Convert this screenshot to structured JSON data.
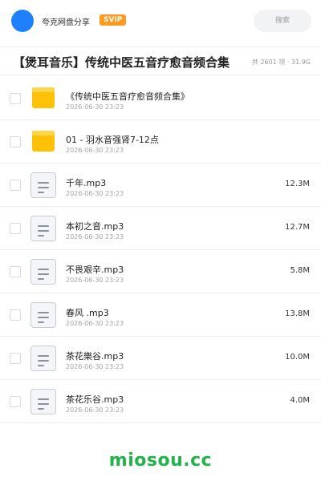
{
  "header": {
    "site_name": "夸克网盘分享",
    "badge": "SVIP",
    "search_label": "搜索"
  },
  "share": {
    "title": "【煲耳音乐】传统中医五音疗愈音频合集",
    "meta": "共 2601 项 · 31.9G"
  },
  "files": [
    {
      "type": "folder",
      "name": "《传统中医五音疗愈音频合集》",
      "date": "2026-06-30 23:23",
      "size": ""
    },
    {
      "type": "folder",
      "name": "01 - 羽水音强肾7-12点",
      "date": "2026-06-30 23:23",
      "size": ""
    },
    {
      "type": "file",
      "name": "千年.mp3",
      "date": "2026-06-30 23:23",
      "size": "12.3M"
    },
    {
      "type": "file",
      "name": "本初之音.mp3",
      "date": "2026-06-30 23:23",
      "size": "12.7M"
    },
    {
      "type": "file",
      "name": "不畏艰辛.mp3",
      "date": "2026-06-30 23:23",
      "size": "5.8M"
    },
    {
      "type": "file",
      "name": "春风 .mp3",
      "date": "2026-06-30 23:23",
      "size": "13.8M"
    },
    {
      "type": "file",
      "name": "茶花樂谷.mp3",
      "date": "2026-06-30 23:23",
      "size": "10.0M"
    },
    {
      "type": "file",
      "name": "茶花乐谷.mp3",
      "date": "2026-06-30 23:23",
      "size": "4.0M"
    }
  ],
  "footer": {
    "brand": "miosou.cc"
  },
  "colors": {
    "avatar": "#1e80ff",
    "badge": "#ff9a1f",
    "folder": "#ffc107",
    "brand": "#21b24a"
  }
}
